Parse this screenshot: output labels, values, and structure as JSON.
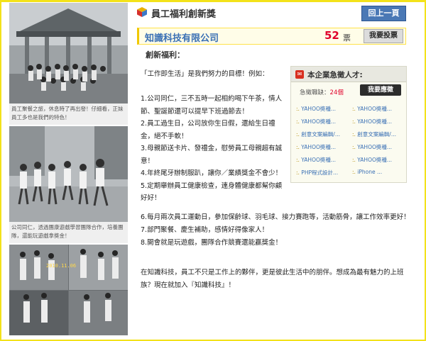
{
  "header": {
    "title": "員工福利創新獎",
    "back_label": "回上一頁"
  },
  "company": {
    "name": "知識科技有限公司",
    "votes": "52",
    "vote_unit": "票",
    "vote_button": "我要投票"
  },
  "section_title": "創新福利：",
  "intro": "「工作即生活」是我們努力的目標！例如：",
  "benefit_lines": [
    "1.公司同仁，三不五時一起相約喝下午茶，情人",
    "節、聖誕節還可以提早下班過節去！",
    "2.員工過生日，公司放你生日假，還給生日禮",
    "金，絕不手軟！",
    "3.母親節送卡片、發禮金，慰勞員工母親超有誠",
    "意！",
    "4.年終尾牙辦制服趴，讓你／業績獎金不會少！",
    "5.定期舉辦員工健康檢查，連身體健康都幫你顧",
    "好好！"
  ],
  "benefit_wide_lines": [
    "6.每月兩次員工運動日，參加保齡球、羽毛球、接力賽跑等，活動筋骨，讓工作效率更好！",
    "7.部門聚餐、慶生補助，感情好得像家人！",
    "8.開會就是玩遊戲，團隊合作競賽還能贏獎金！"
  ],
  "closing_lines": [
    "在知識科技，員工不只是工作上的夥伴，更是彼此生活中的朋伴。想成為最有魅力的上班",
    "族？現在就加入『知識科技』！"
  ],
  "jobs": {
    "title": "本企業急徵人才:",
    "count_label": "急徵職缺：",
    "count": "24個",
    "apply_button": "我要應徵",
    "items": [
      [
        "YAHOO奬種...",
        "YAHOO奬種..."
      ],
      [
        "YAHOO奬種...",
        "YAHOO奬種..."
      ],
      [
        "創意文案編輯/...",
        "創意文案編輯/..."
      ],
      [
        "YAHOO奬種...",
        "YAHOO奬種..."
      ],
      [
        "YAHOO奬種...",
        "YAHOO奬種..."
      ],
      [
        "PHP程式設計...",
        "iPhone ..."
      ]
    ]
  },
  "photos": {
    "captions": [
      "員工聚餐之旅，休息時了再出發！仔細看，正妹員工多也是我們的特色！",
      "公司同仁，透過團康遊戲學習團隊合作，培養團隊，還能玩遊戲拿獎金！"
    ],
    "date_stamp": "2010.11.06"
  },
  "colors": {
    "frame": "#f3e21a",
    "back_button": "#4a78b5",
    "company_name": "#3a70b5",
    "vote_count": "#e0002a",
    "job_link": "#3a70b5"
  }
}
